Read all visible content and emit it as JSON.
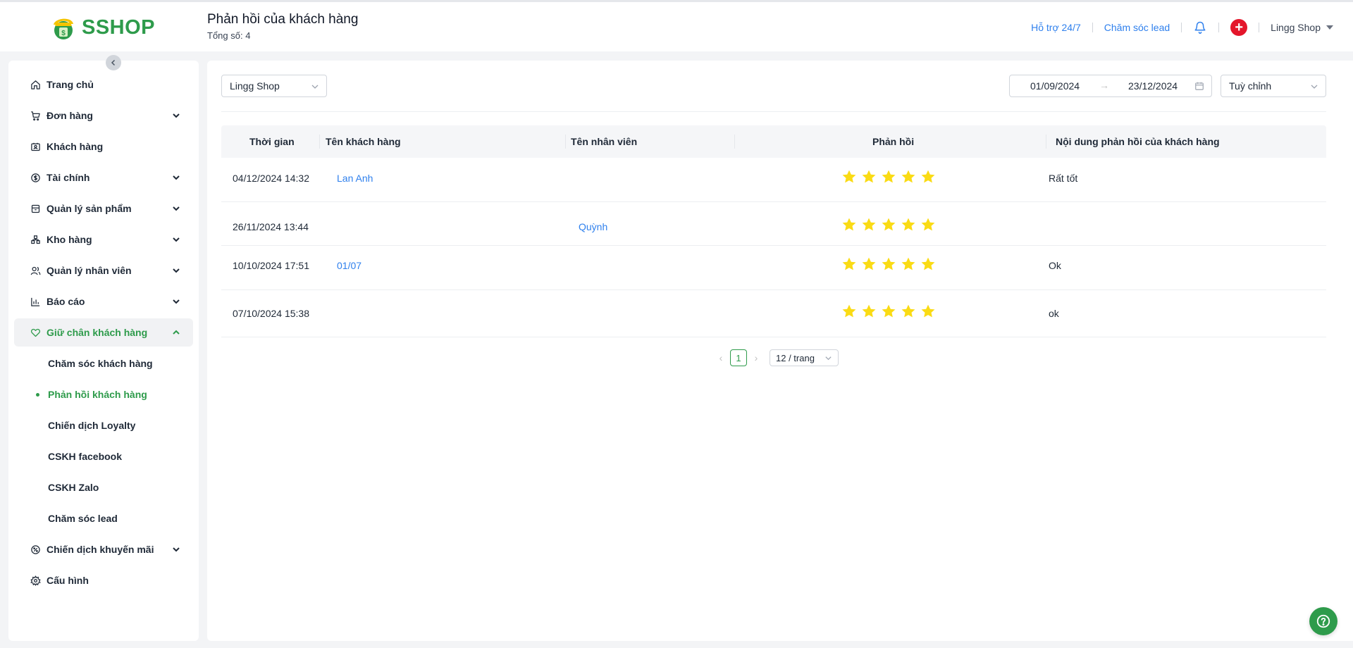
{
  "brand": {
    "logo_text": "SSHOP",
    "accent": "#2e9b4b",
    "link_color": "#2f80ed"
  },
  "header": {
    "title": "Phản hồi của khách hàng",
    "subtitle": "Tổng số: 4",
    "support_link": "Hỗ trợ 24/7",
    "lead_link": "Chăm sóc lead",
    "bell_icon": "bell-icon",
    "plus_icon": "plus-icon",
    "shop_name": "Lingg Shop"
  },
  "sidebar": {
    "items": [
      {
        "label": "Trang chủ",
        "icon": "home-icon",
        "has_children": false
      },
      {
        "label": "Đơn hàng",
        "icon": "cart-icon",
        "has_children": true
      },
      {
        "label": "Khách hàng",
        "icon": "contact-card-icon",
        "has_children": false
      },
      {
        "label": "Tài chính",
        "icon": "dollar-circle-icon",
        "has_children": true
      },
      {
        "label": "Quản lý sản phẩm",
        "icon": "box-icon",
        "has_children": true
      },
      {
        "label": "Kho hàng",
        "icon": "warehouse-icon",
        "has_children": true
      },
      {
        "label": "Quản lý nhân viên",
        "icon": "user-group-icon",
        "has_children": true
      },
      {
        "label": "Báo cáo",
        "icon": "bar-chart-icon",
        "has_children": true
      },
      {
        "label": "Giữ chân khách hàng",
        "icon": "heart-icon",
        "has_children": true,
        "active": true
      }
    ],
    "sub_items": [
      {
        "label": "Chăm sóc khách hàng"
      },
      {
        "label": "Phản hồi khách hàng",
        "active": true
      },
      {
        "label": "Chiến dịch Loyalty"
      },
      {
        "label": "CSKH facebook"
      },
      {
        "label": "CSKH Zalo"
      },
      {
        "label": "Chăm sóc lead"
      }
    ],
    "bottom_items": [
      {
        "label": "Chiến dịch khuyến mãi",
        "icon": "discount-icon",
        "has_children": true
      },
      {
        "label": "Cấu hình",
        "icon": "gear-icon",
        "has_children": false
      }
    ]
  },
  "filters": {
    "shop_select": "Lingg Shop",
    "date_from": "01/09/2024",
    "date_to": "23/12/2024",
    "date_arrow": "→",
    "range_select": "Tuỳ chỉnh"
  },
  "table": {
    "columns": [
      "Thời gian",
      "Tên khách hàng",
      "Tên nhân viên",
      "Phản hồi",
      "Nội dung phản hồi của khách hàng"
    ],
    "rows": [
      {
        "time": "04/12/2024 14:32",
        "customer": "Lan Anh",
        "staff": "",
        "rating": 5,
        "content": "Rất tốt"
      },
      {
        "time": "26/11/2024 13:44",
        "customer": "",
        "staff": "Quỳnh",
        "rating": 5,
        "content": ""
      },
      {
        "time": "10/10/2024 17:51",
        "customer": "01/07",
        "staff": "",
        "rating": 5,
        "content": "Ok"
      },
      {
        "time": "07/10/2024 15:38",
        "customer": "",
        "staff": "",
        "rating": 5,
        "content": "ok"
      }
    ]
  },
  "pagination": {
    "current_page": "1",
    "page_size": "12 / trang"
  },
  "help": {
    "icon": "help-icon"
  },
  "star_color": "#fadb14"
}
